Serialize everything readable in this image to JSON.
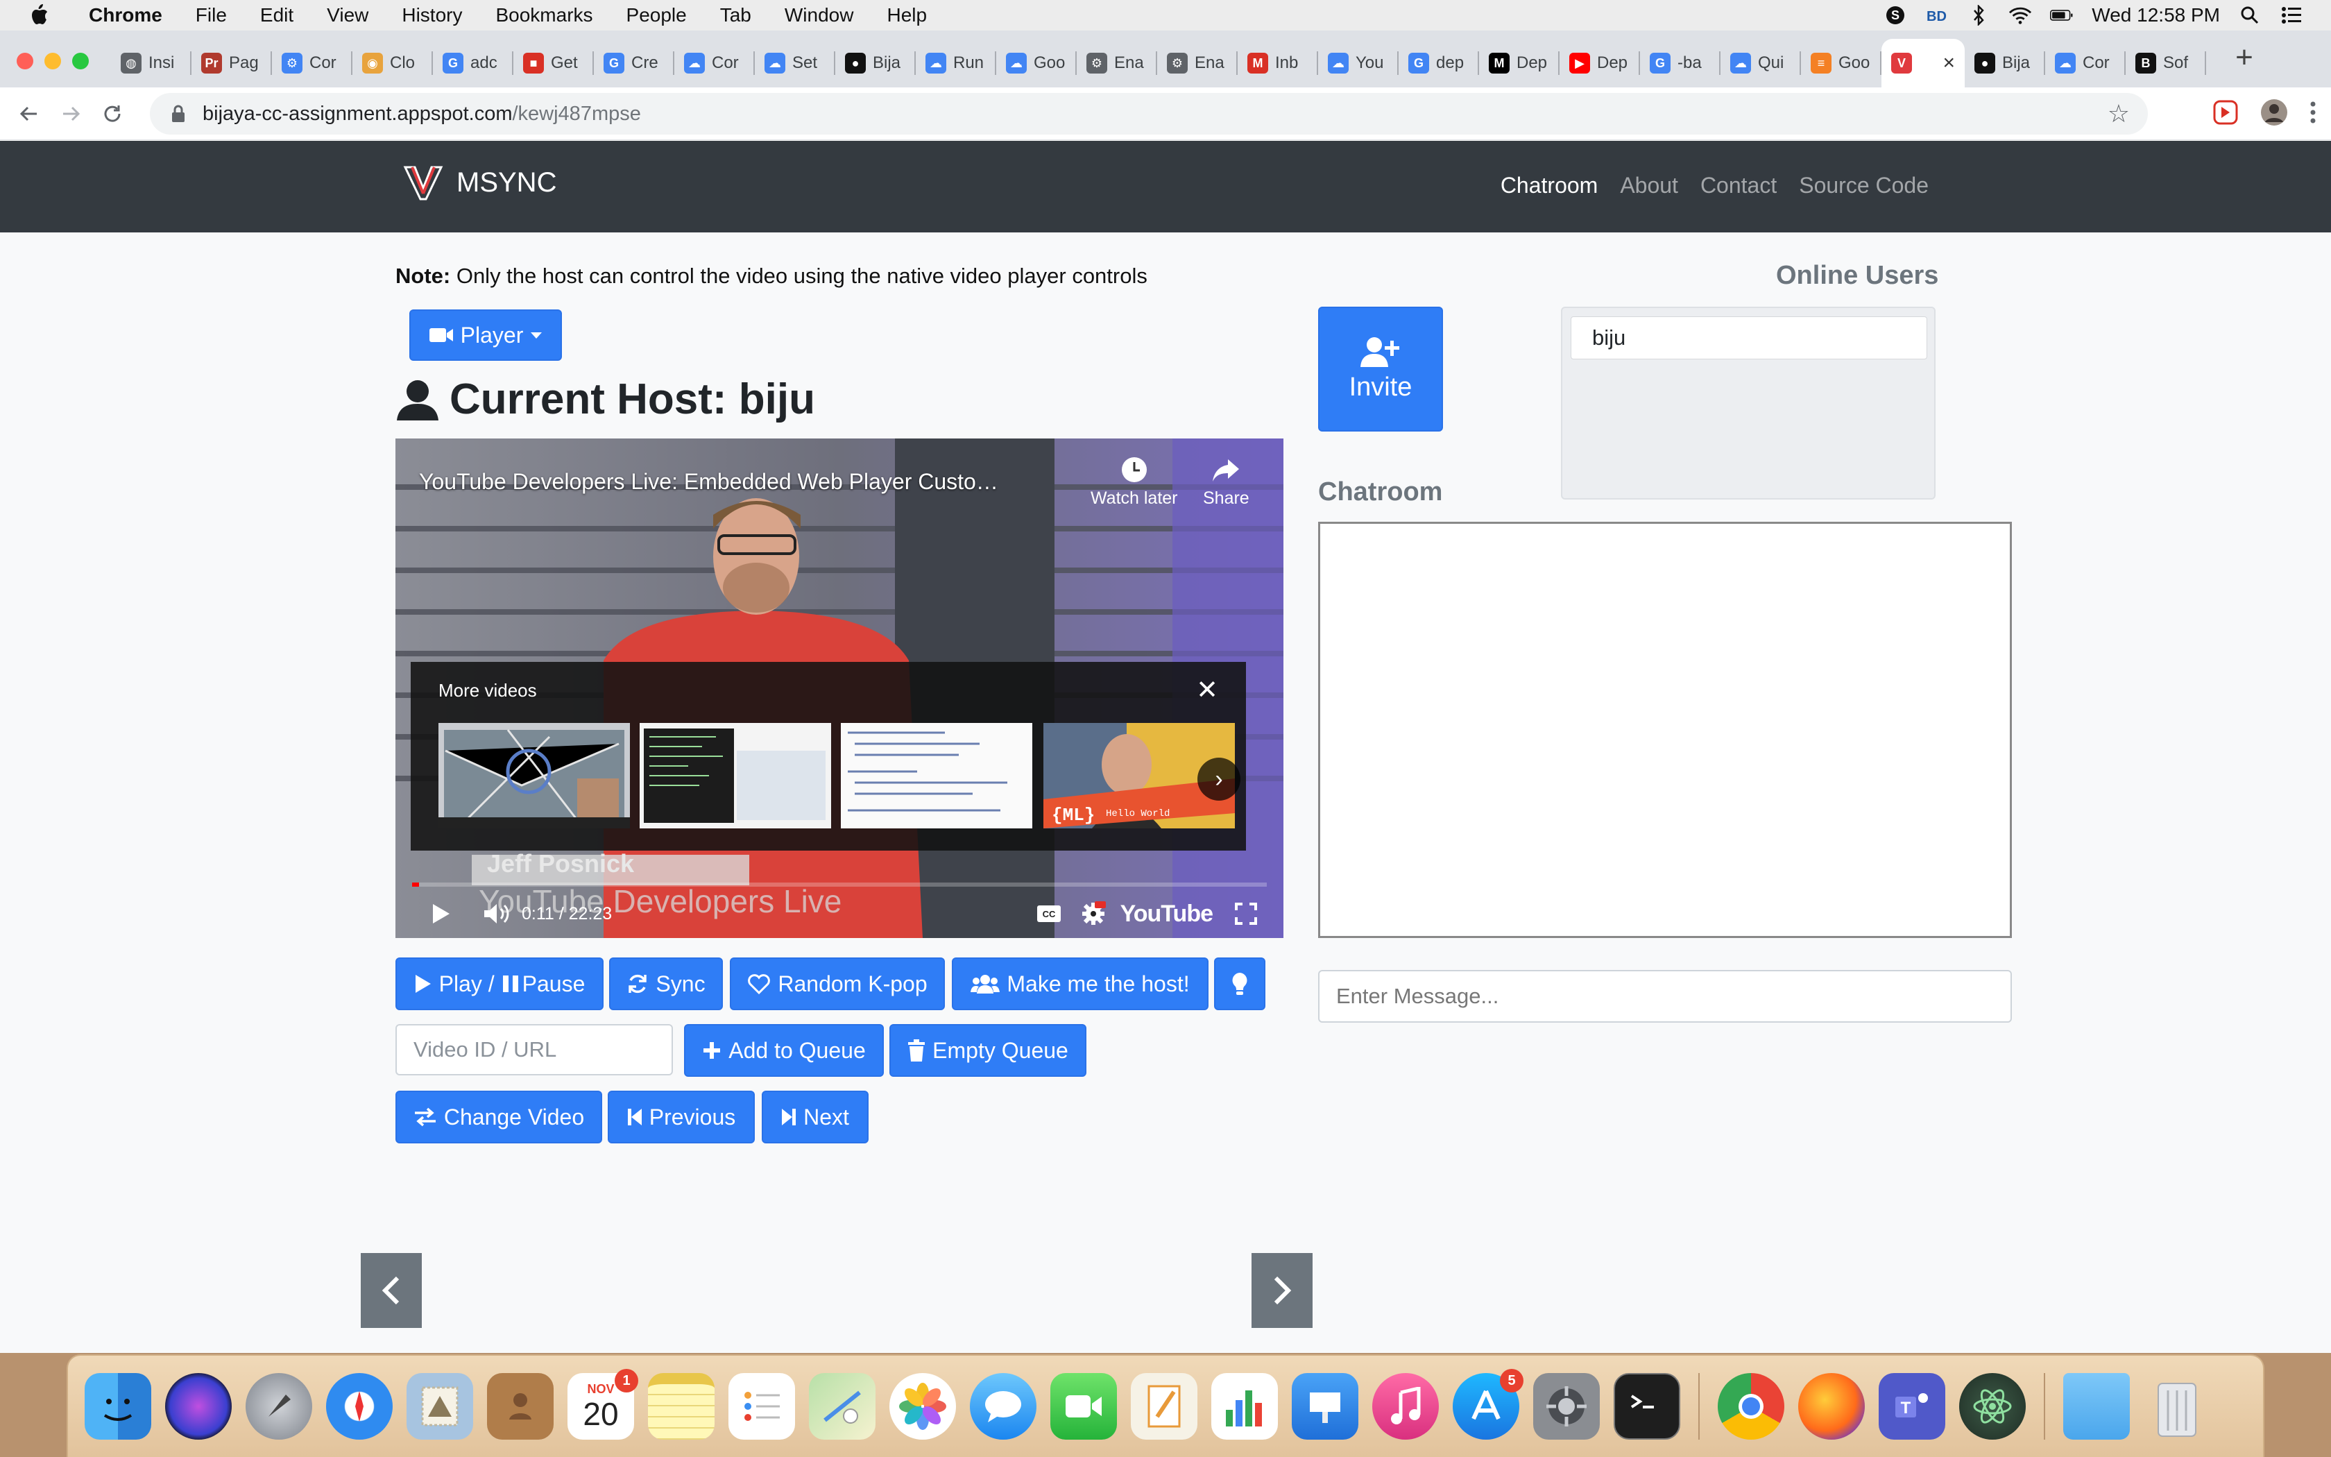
{
  "menubar": {
    "app_name": "Chrome",
    "items": [
      "File",
      "Edit",
      "View",
      "History",
      "Bookmarks",
      "People",
      "Tab",
      "Window",
      "Help"
    ],
    "clock": "Wed 12:58 PM"
  },
  "tabs": [
    {
      "label": "Insi",
      "icon": "globe-icon",
      "color": "#5f6368"
    },
    {
      "label": "Pag",
      "icon": "pr-icon",
      "color": "#b03a2e"
    },
    {
      "label": "Cor",
      "icon": "chip-icon",
      "color": "#4285f4"
    },
    {
      "label": "Clo",
      "icon": "chrome-icon",
      "color": "#e8a33d"
    },
    {
      "label": "adc",
      "icon": "google-icon",
      "color": "#4285f4"
    },
    {
      "label": "Get",
      "icon": "gift-icon",
      "color": "#d93025"
    },
    {
      "label": "Cre",
      "icon": "google-icon",
      "color": "#4285f4"
    },
    {
      "label": "Cor",
      "icon": "cloud-icon",
      "color": "#4285f4"
    },
    {
      "label": "Set",
      "icon": "cloud-icon",
      "color": "#4285f4"
    },
    {
      "label": "Bija",
      "icon": "github-icon",
      "color": "#111111"
    },
    {
      "label": "Run",
      "icon": "cloud-icon",
      "color": "#4285f4"
    },
    {
      "label": "Goo",
      "icon": "cloud-icon",
      "color": "#4285f4"
    },
    {
      "label": "Ena",
      "icon": "gear-icon",
      "color": "#5f6368"
    },
    {
      "label": "Ena",
      "icon": "gear-icon",
      "color": "#5f6368"
    },
    {
      "label": "Inb",
      "icon": "gmail-icon",
      "color": "#d93025"
    },
    {
      "label": "You",
      "icon": "cloud-icon",
      "color": "#4285f4"
    },
    {
      "label": "dep",
      "icon": "google-icon",
      "color": "#4285f4"
    },
    {
      "label": "Dep",
      "icon": "medium-icon",
      "color": "#000000"
    },
    {
      "label": "Dep",
      "icon": "youtube-icon",
      "color": "#ff0000"
    },
    {
      "label": "-ba",
      "icon": "google-icon",
      "color": "#4285f4"
    },
    {
      "label": "Qui",
      "icon": "cloud-icon",
      "color": "#4285f4"
    },
    {
      "label": "Goo",
      "icon": "stack-icon",
      "color": "#f48024"
    },
    {
      "label": "",
      "icon": "msync-icon",
      "color": "#e03a3e",
      "active": true
    },
    {
      "label": "Bija",
      "icon": "github-icon",
      "color": "#111111"
    },
    {
      "label": "Cor",
      "icon": "cloud-icon",
      "color": "#4285f4"
    },
    {
      "label": "Sof",
      "icon": "bold-b-icon",
      "color": "#111111"
    }
  ],
  "omnibox": {
    "host": "bijaya-cc-assignment.appspot.com",
    "path": "/kewj487mpse"
  },
  "site": {
    "brand": "MSYNC",
    "nav": [
      {
        "label": "Chatroom",
        "active": true
      },
      {
        "label": "About"
      },
      {
        "label": "Contact"
      },
      {
        "label": "Source Code"
      }
    ]
  },
  "note": {
    "label": "Note:",
    "text": " Only the host can control the video using the native video player controls"
  },
  "player_dropdown": "Player",
  "host": {
    "title": "Current Host: biju"
  },
  "video": {
    "title": "YouTube Developers Live: Embedded Web Player Custo…",
    "watch_later": "Watch later",
    "share": "Share",
    "more_videos": "More videos",
    "lower_third_name": "Jeff Posnick",
    "lower_third_show": "YouTube Developers Live",
    "time": "0:11 / 22:23",
    "progress": 0.008,
    "thumb_ml_text": "{ML}",
    "thumb_ml_sub": "Hello World",
    "youtube_logo": "YouTube"
  },
  "controls": {
    "play_pause": "Play / ",
    "pause": "Pause",
    "sync": "Sync",
    "random_kpop": "Random K-pop",
    "make_host": "Make me the host!",
    "video_placeholder": "Video ID / URL",
    "add_queue": "Add to Queue",
    "empty_queue": "Empty Queue",
    "change_video": "Change Video",
    "previous": "Previous",
    "next": "Next"
  },
  "sidebar": {
    "invite": "Invite",
    "online_title": "Online Users",
    "users": [
      "biju"
    ],
    "chatroom_title": "Chatroom",
    "message_placeholder": "Enter Message..."
  },
  "dock": {
    "calendar_month": "NOV",
    "calendar_day": "20",
    "calendar_badge": "1",
    "appstore_badge": "5"
  },
  "colors": {
    "primary": "#2f7df6",
    "navbar": "#343a40",
    "secondary": "#6c757d"
  }
}
